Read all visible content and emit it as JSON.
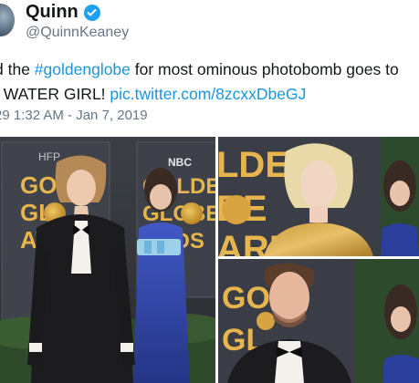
{
  "tweet": {
    "display_name": "Quinn",
    "handle": "@QuinnKeaney",
    "text": {
      "line1_prefix": "d the ",
      "hashtag": "#goldenglobe",
      "line1_suffix": " for most ominous photobomb goes to",
      "line2_prefix": "I WATER GIRL! ",
      "link": "pic.twitter.com/8zcxxDbeGJ"
    },
    "time": "29   1:32 AM - Jan 7, 2019"
  },
  "media": {
    "backdrop_text_left": [
      "GOLD",
      "GL",
      "AW"
    ],
    "backdrop_hfp": "HFP",
    "backdrop_text_mid": [
      "GOLDE",
      "GLOBE",
      "ARDS"
    ],
    "nbc": "NBC",
    "backdrop_text_tr": [
      "LDEN",
      "BE",
      "ARE"
    ],
    "backdrop_text_br": [
      "GO",
      "GL"
    ],
    "colors": {
      "backdrop": "#3b3f47",
      "gold": "#d8a441",
      "blue_dress": "#2b3f9c",
      "suit": "#1c1c1e"
    }
  }
}
